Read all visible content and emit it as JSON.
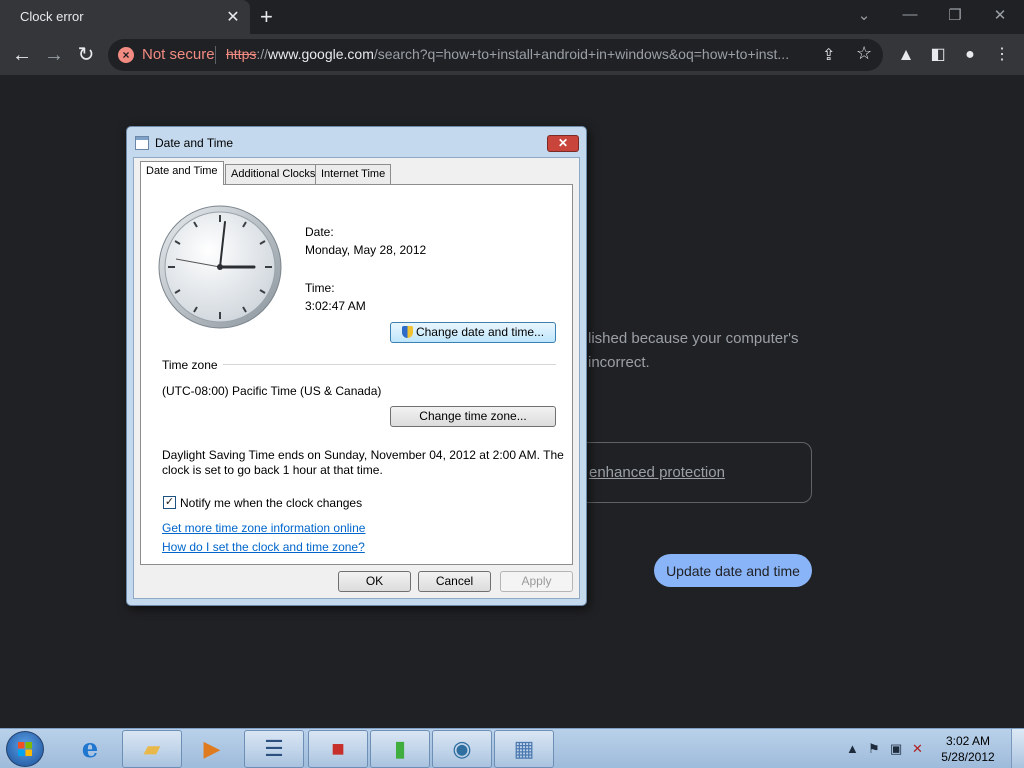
{
  "browser": {
    "tab_title": "Clock error",
    "tab_close": "✕",
    "new_tab": "+",
    "security_label": "Not secure",
    "url_scheme": "https",
    "url_sep": "://",
    "url_host": "www.google.com",
    "url_rest": "/search?q=how+to+install+android+in+windows&oq=how+to+inst..."
  },
  "page": {
    "error_text": "lished because your computer's incorrect.",
    "protection_link": "enhanced protection",
    "update_button": "Update date and time"
  },
  "dialog": {
    "title": "Date and Time",
    "close": "✕",
    "tabs": [
      "Date and Time",
      "Additional Clocks",
      "Internet Time"
    ],
    "date_label": "Date:",
    "date_value": "Monday, May 28, 2012",
    "time_label": "Time:",
    "time_value": "3:02:47 AM",
    "change_datetime_button": "Change date and time...",
    "timezone_header": "Time zone",
    "timezone_value": "(UTC-08:00) Pacific Time (US & Canada)",
    "change_timezone_button": "Change time zone...",
    "dst_line1": "Daylight Saving Time ends on Sunday, November 04, 2012 at 2:00 AM. The",
    "dst_line2": "clock is set to go back 1 hour at that time.",
    "notify_checkbox_label": "Notify me when the clock changes",
    "notify_checked": true,
    "link_timezone_info": "Get more time zone information online",
    "link_how_set": "How do I set the clock and time zone?",
    "ok_button": "OK",
    "cancel_button": "Cancel",
    "apply_button": "Apply"
  },
  "taskbar": {
    "apps": [
      "internet-explorer",
      "windows-explorer",
      "media-player",
      "task-list",
      "toolbox",
      "green-app",
      "network-globe",
      "calendar-clock"
    ],
    "tray_time": "3:02 AM",
    "tray_date": "5/28/2012"
  }
}
